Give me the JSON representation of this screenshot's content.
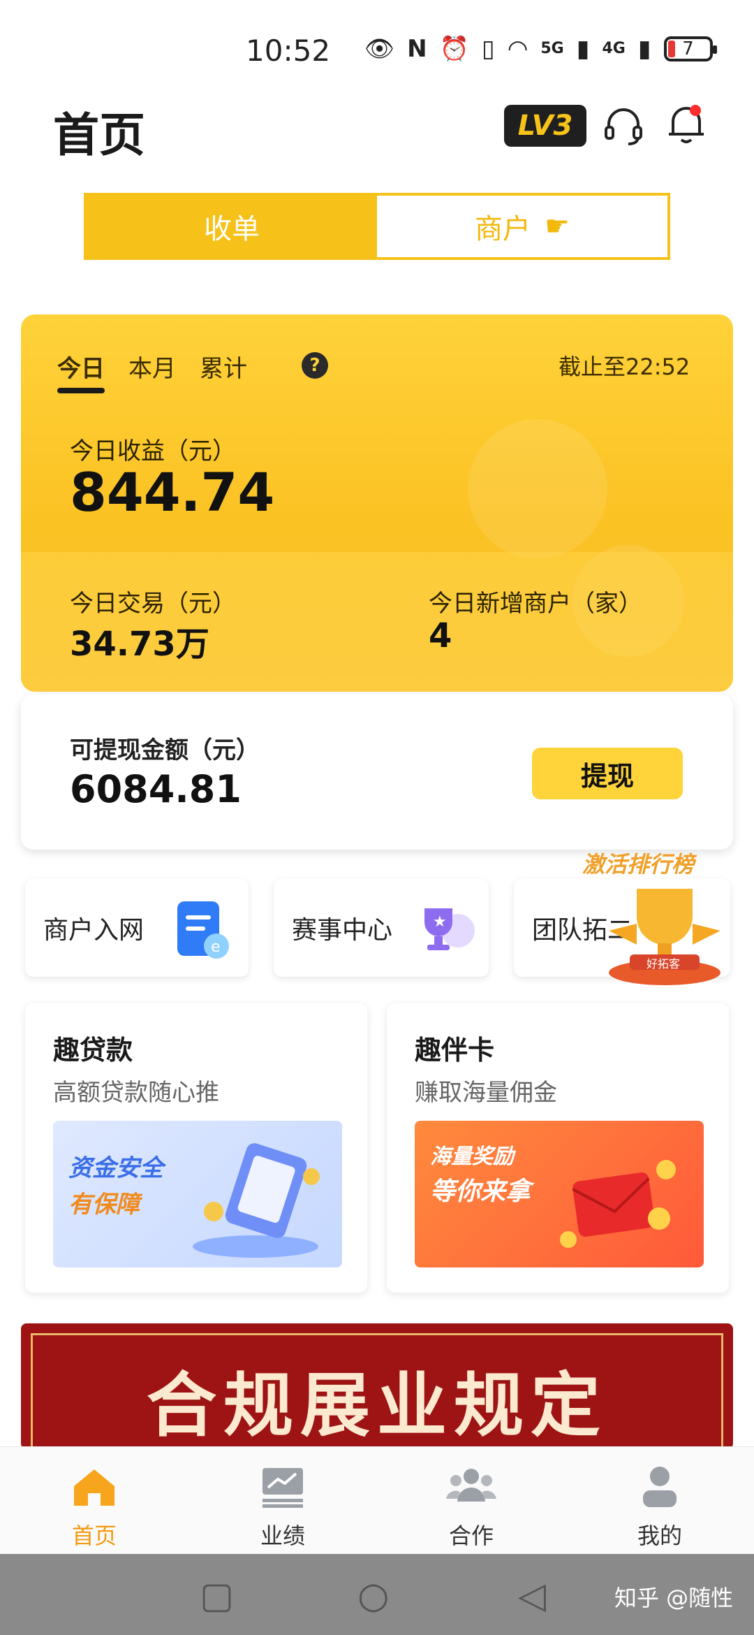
{
  "status_bar": {
    "time": "10:52",
    "battery": "7",
    "net1": "5G",
    "net2": "4G"
  },
  "header": {
    "title": "首页",
    "level_badge": "LV3"
  },
  "segmented": {
    "tab1": "收单",
    "tab2": "商户"
  },
  "summary": {
    "tabs": [
      "今日",
      "本月",
      "累计"
    ],
    "help": "?",
    "as_of": "截止至22:52",
    "income_label": "今日收益（元）",
    "income_value": "844.74",
    "trade_label": "今日交易（元）",
    "trade_value": "34.73万",
    "merchants_label": "今日新增商户（家）",
    "merchants_value": "4"
  },
  "withdraw": {
    "label": "可提现金额（元）",
    "value": "6084.81",
    "button": "提现"
  },
  "quick": {
    "item1": "商户入网",
    "item2": "赛事中心",
    "item3": "团队拓二",
    "rank_title": "激活排行榜",
    "rank_badge": "好拓客"
  },
  "promo1": {
    "title": "趣贷款",
    "subtitle": "高额贷款随心推",
    "banner_line1": "资金安全",
    "banner_line2": "有保障"
  },
  "promo2": {
    "title": "趣伴卡",
    "subtitle": "赚取海量佣金",
    "banner_line1": "海量奖励",
    "banner_line2": "等你来拿"
  },
  "compliance": {
    "text": "合规展业规定"
  },
  "nav": {
    "home": "首页",
    "perf": "业绩",
    "coop": "合作",
    "mine": "我的"
  },
  "colors": {
    "accent": "#f6c21a",
    "card": "#fbc223",
    "banner_red": "#9e1414"
  },
  "watermark": "知乎 @随性"
}
